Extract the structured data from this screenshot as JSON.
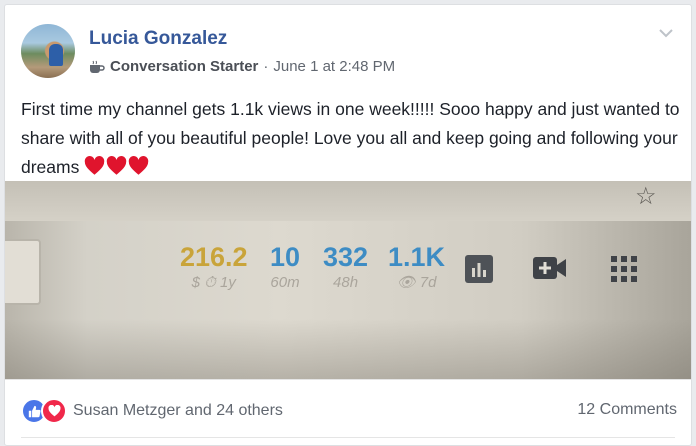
{
  "post": {
    "author": "Lucia Gonzalez",
    "group": "Conversation Starter",
    "separator": "·",
    "timestamp": "June 1 at 2:48 PM",
    "text": "First time my channel gets 1.1k views in one week!!!!! Sooo happy and just wanted to share with all of you beautiful people! Love you all and keep going and following your dreams",
    "emoji": [
      "❤️",
      "❤️",
      "❤️"
    ]
  },
  "photo": {
    "stats": [
      {
        "value": "216.2",
        "label": "$ ⏱ 1y",
        "color": "#c9a43a"
      },
      {
        "value": "10",
        "label": "60m",
        "color": "#3d8cc4"
      },
      {
        "value": "332",
        "label": "48h",
        "color": "#3d8cc4"
      },
      {
        "value": "1.1K",
        "label": "👁 7d",
        "color": "#3d8cc4"
      }
    ],
    "icons": [
      "bar-chart-icon",
      "video-add-icon",
      "apps-grid-icon",
      "star-icon"
    ]
  },
  "footer": {
    "reactions": [
      "like",
      "love"
    ],
    "reaction_names": "Susan Metzger and 24 others",
    "comments": "12 Comments"
  },
  "colors": {
    "link": "#365899",
    "like": "#4a76e8",
    "love": "#f0284a",
    "heart": "#e0142d"
  }
}
